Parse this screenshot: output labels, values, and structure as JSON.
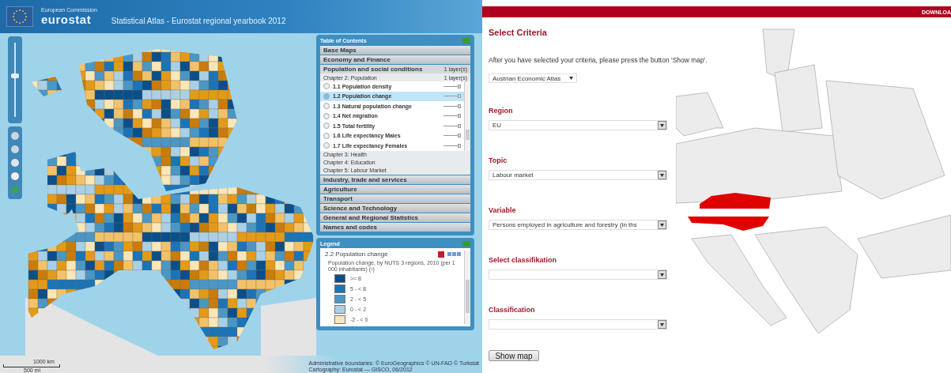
{
  "left_app": {
    "header": {
      "organization": "European Commission",
      "logo_text": "eurostat",
      "title": "Statistical Atlas - Eurostat regional yearbook 2012"
    },
    "table_of_contents": {
      "title": "Table of Contents",
      "themes": [
        {
          "label": "Base Maps",
          "expanded": false
        },
        {
          "label": "Economy and Finance",
          "expanded": false
        },
        {
          "label": "Population and social conditions",
          "expanded": true,
          "layer_count": "1 layer(s)",
          "chapters": [
            {
              "label": "Chapter 2: Population",
              "layer_count": "1 layer(s)",
              "expanded": true,
              "items": [
                {
                  "label": "1.1 Population density",
                  "selected": false,
                  "level": 0.9
                },
                {
                  "label": "1.2 Population change",
                  "selected": true,
                  "level": 0.9
                },
                {
                  "label": "1.3 Natural population change",
                  "selected": false,
                  "level": 0.9
                },
                {
                  "label": "1.4 Net migration",
                  "selected": false,
                  "level": 0.9
                },
                {
                  "label": "1.5 Total fertility",
                  "selected": false,
                  "level": 0.9
                },
                {
                  "label": "1.6 Life expectancy Males",
                  "selected": false,
                  "level": 0.9
                },
                {
                  "label": "1.7 Life expectancy Females",
                  "selected": false,
                  "level": 0.9
                }
              ]
            },
            {
              "label": "Chapter 3: Health",
              "expanded": false
            },
            {
              "label": "Chapter 4: Education",
              "expanded": false
            },
            {
              "label": "Chapter 5: Labour Market",
              "expanded": false
            }
          ]
        },
        {
          "label": "Industry, trade and services",
          "expanded": false
        },
        {
          "label": "Agriculture",
          "expanded": false
        },
        {
          "label": "Transport",
          "expanded": false
        },
        {
          "label": "Science and Technology",
          "expanded": false
        },
        {
          "label": "General and Regional Statistics",
          "expanded": false
        },
        {
          "label": "Names and codes",
          "expanded": false
        }
      ]
    },
    "zoom": {
      "level": 0.55
    },
    "legend": {
      "title": "Legend",
      "layer": "2.2 Population change",
      "description": "Population change, by NUTS 3 regions, 2010 (per 1 000 inhabitants) (¹)",
      "classes": [
        {
          "label": ">= 8",
          "color": "#0b4f8a"
        },
        {
          "label": "5 - < 8",
          "color": "#1b74b8"
        },
        {
          "label": "2 - < 5",
          "color": "#4a97c6"
        },
        {
          "label": "0 - < 2",
          "color": "#a9d0e6"
        },
        {
          "label": "-2 - < 0",
          "color": "#fbe6b8"
        }
      ]
    },
    "scale": [
      "1000 km",
      "500 mi"
    ],
    "attribution": [
      "Administrative boundaries: © EuroGeographics © UN-FAO © Turkstat",
      "Cartography: Eurostat — GISCO, 06/2012"
    ]
  },
  "right_app": {
    "top_link": "DOWNLOA",
    "title": "Select Criteria",
    "instruction": "After you have selected your criteria, please press the button 'Show map'.",
    "atlas": "Austrian Economic Atlas",
    "fields": [
      {
        "label": "Region",
        "value": "EU"
      },
      {
        "label": "Topic",
        "value": "Labour market"
      },
      {
        "label": "Variable",
        "value": "Persons employed in agriculture and forestry (in ths"
      },
      {
        "label": "Select classifikation"
      },
      {
        "label": "Classification"
      }
    ],
    "button": "Show map"
  }
}
